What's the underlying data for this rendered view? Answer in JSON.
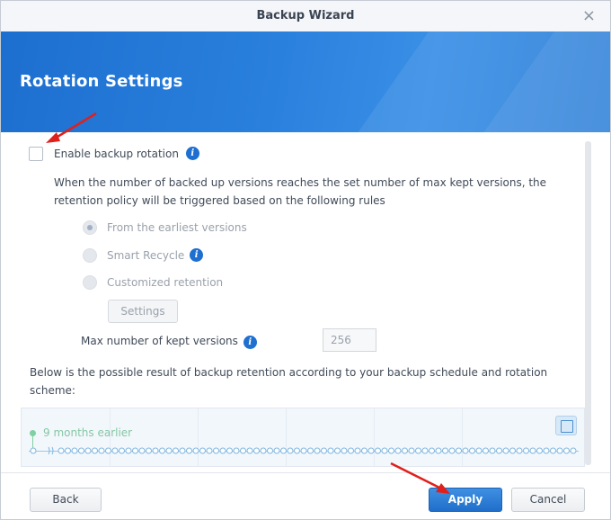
{
  "window": {
    "title": "Backup Wizard",
    "close_glyph": "×"
  },
  "banner": {
    "heading": "Rotation Settings"
  },
  "rotation": {
    "enable_label": "Enable backup rotation",
    "enabled": false,
    "description_line1": "When the number of backed up versions reaches the set number of max kept versions, the",
    "description_line2": "retention policy will be triggered based on the following rules",
    "options": [
      {
        "label": "From the earliest versions",
        "selected": true
      },
      {
        "label": "Smart Recycle",
        "selected": false
      },
      {
        "label": "Customized retention",
        "selected": false
      }
    ],
    "settings_button": "Settings",
    "max_versions_label": "Max number of kept versions",
    "max_versions_value": "256",
    "result_line1": "Below is the possible result of backup retention according to your backup schedule and rotation",
    "result_line2": "scheme:"
  },
  "timeline": {
    "start_label": "9 months earlier"
  },
  "footer": {
    "back": "Back",
    "apply": "Apply",
    "cancel": "Cancel"
  },
  "icons": {
    "info": "info-icon",
    "calendar": "calendar-icon",
    "close": "close-icon"
  },
  "colors": {
    "accent": "#1f6fcb",
    "banner": "#2a80dd",
    "annotation_arrow": "#e0201b"
  }
}
